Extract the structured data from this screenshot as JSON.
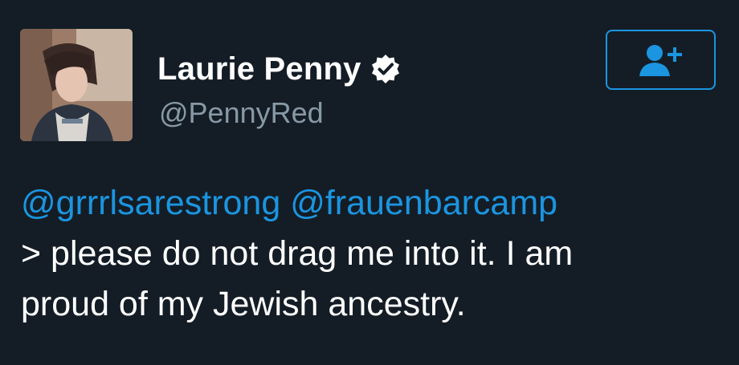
{
  "tweet": {
    "author": {
      "display_name": "Laurie Penny",
      "handle": "@PennyRed",
      "verified": true,
      "avatar_icon": "user-photo-avatar",
      "verified_icon": "verified-badge-icon"
    },
    "follow_button": {
      "icon": "follow-user-plus-icon"
    },
    "mentions": [
      "@grrrlsarestrong",
      "@frauenbarcamp"
    ],
    "lines": [
      "> please do not drag me into it. I am",
      "proud of my Jewish ancestry."
    ]
  },
  "colors": {
    "background": "#141d26",
    "text": "#ffffff",
    "secondary_text": "#8899a6",
    "accent": "#1b95e0"
  }
}
